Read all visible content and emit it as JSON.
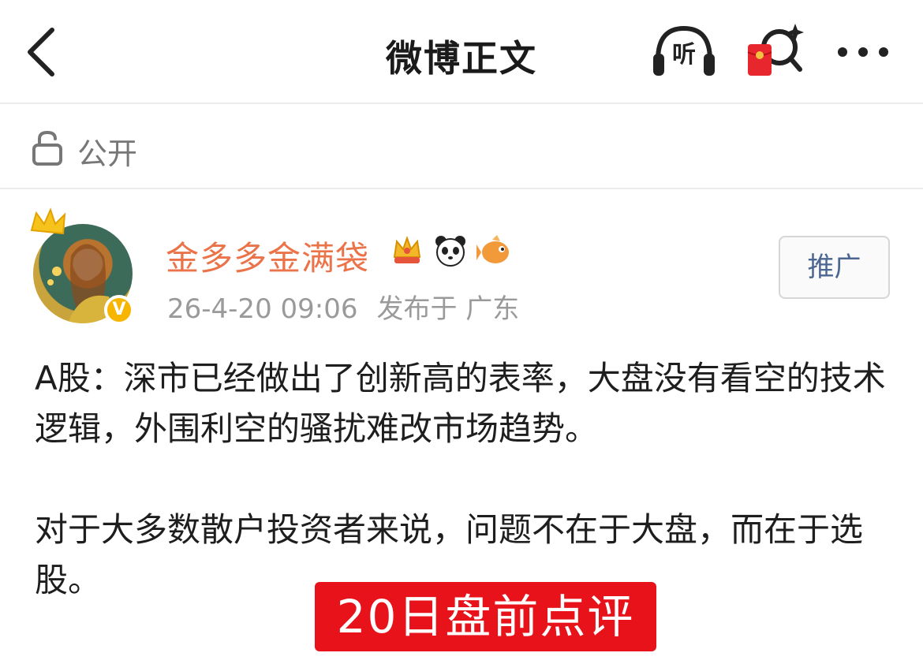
{
  "header": {
    "title": "微博正文",
    "listen_label": "听",
    "icons": [
      "back-arrow-icon",
      "headphones-icon",
      "red-packet-icon",
      "more-icon"
    ]
  },
  "visibility": {
    "label": "公开",
    "icon": "unlock-icon"
  },
  "author": {
    "name": "金多多金满袋",
    "verified_mark": "V",
    "badges": [
      "crown-badge-icon",
      "panda-badge-icon",
      "fish-badge-icon"
    ],
    "time": "26-4-20 09:06",
    "location": "发布于 广东",
    "promote_label": "推广"
  },
  "post": {
    "paragraphs": [
      "A股：深市已经做出了创新高的表率，大盘没有看空的技术逻辑，外围利空的骚扰难改市场趋势。",
      "对于大多数散户投资者来说，问题不在于大盘，而在于选股。"
    ],
    "overlay_label": "20日盘前点评"
  },
  "colors": {
    "username": "#eb7349",
    "promote_text": "#4b6691",
    "overlay_bg": "#e8121b",
    "meta": "#9a9a9a"
  }
}
